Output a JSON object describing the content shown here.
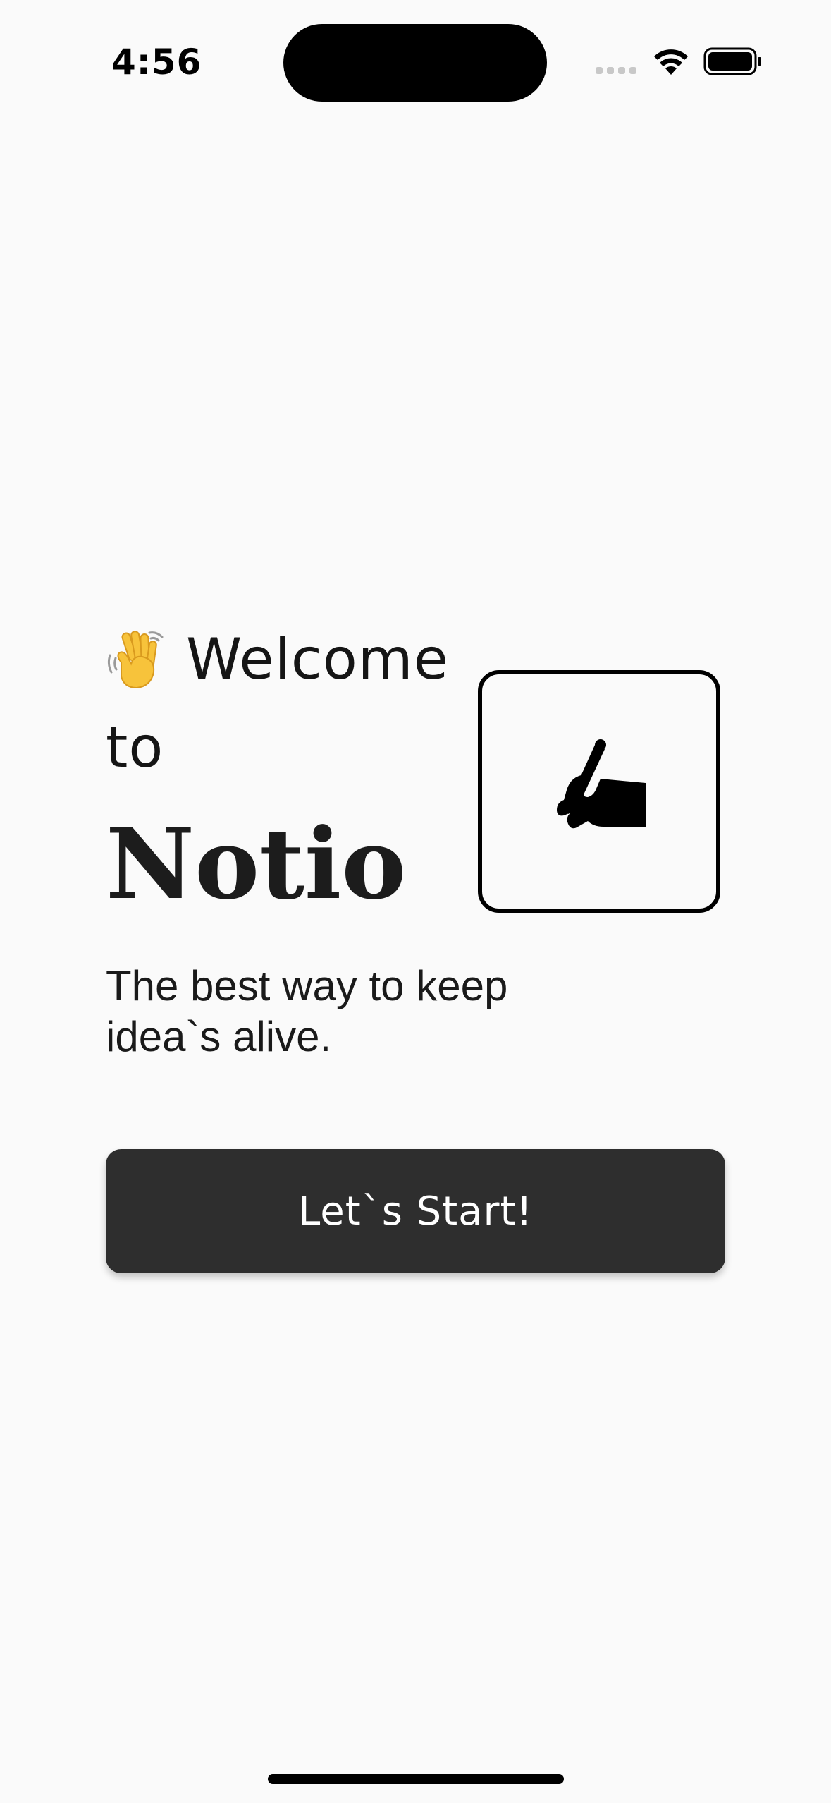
{
  "status_bar": {
    "time": "4:56",
    "icons": [
      "signal-icon",
      "wifi-icon",
      "battery-icon"
    ]
  },
  "welcome": {
    "emoji": "waving-hand",
    "line1": "Welcome",
    "line2": "to",
    "app_name": "Notio"
  },
  "logo": {
    "icon": "writing-hand-icon"
  },
  "tagline": {
    "line1": "The best way to keep",
    "line2": "idea`s alive."
  },
  "start_button": {
    "label": "Let`s Start!"
  },
  "colors": {
    "background": "#fafafa",
    "button": "#2e2e2e",
    "button_text": "#ffffff",
    "text": "#1a1a1a",
    "emoji_yellow": "#f7c33b"
  }
}
